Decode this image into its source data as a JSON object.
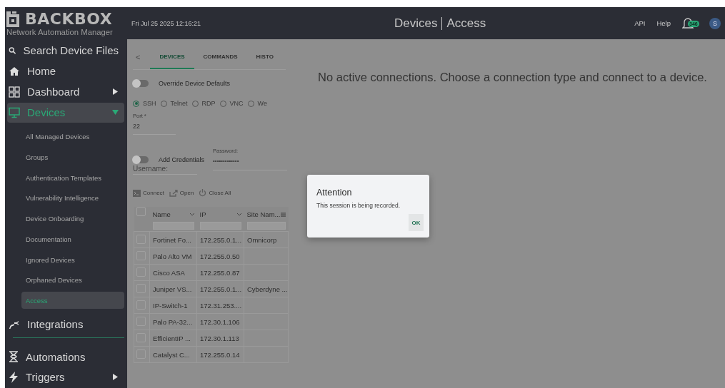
{
  "header": {
    "logo": "BACKBOX",
    "subtitle": "Network Automation Manager",
    "datetime": "Fri Jul 25 2025 12:16:21",
    "title": "Devices",
    "subtitle_right": "Access",
    "links": [
      "API",
      "Help"
    ],
    "notifications": "346",
    "avatar": "S"
  },
  "sidebar": {
    "items": [
      {
        "label": "Search Device Files",
        "selected": false
      },
      {
        "label": "Home",
        "selected": false
      },
      {
        "label": "Dashboard",
        "selected": false,
        "expanded": false
      },
      {
        "label": "Devices",
        "selected": true,
        "expanded": true,
        "children": [
          {
            "label": "All Managed Devices",
            "selected": false
          },
          {
            "label": "Groups",
            "selected": false
          },
          {
            "label": "Authentication Templates",
            "selected": false
          },
          {
            "label": "Vulnerability Intelligence",
            "selected": false
          },
          {
            "label": "Device Onboarding",
            "selected": false
          },
          {
            "label": "Documentation",
            "selected": false
          },
          {
            "label": "Ignored Devices",
            "selected": false
          },
          {
            "label": "Orphaned Devices",
            "selected": false
          },
          {
            "label": "Access",
            "selected": true
          }
        ]
      },
      {
        "label": "Integrations",
        "selected": false
      },
      {
        "label": "Automations",
        "selected": false
      },
      {
        "label": "Triggers",
        "selected": false,
        "expanded": false
      }
    ]
  },
  "tabs_prev": "<",
  "tabs": [
    {
      "label": "DEVICES",
      "selected": true
    },
    {
      "label": "COMMANDS",
      "selected": false
    },
    {
      "label": "HISTO",
      "selected": false
    }
  ],
  "override_defaults": {
    "label": "Override Device Defaults",
    "on": false
  },
  "protocols": [
    {
      "label": "SSH",
      "selected": true
    },
    {
      "label": "Telnet",
      "selected": false
    },
    {
      "label": "RDP",
      "selected": false
    },
    {
      "label": "VNC",
      "selected": false
    },
    {
      "label": "We",
      "selected": false
    }
  ],
  "port": {
    "label": "Port *",
    "value": "22"
  },
  "credentials": {
    "label": "Add Credentials",
    "on": false,
    "username_placeholder": "Username:",
    "password_label": "Password:",
    "password_value": "•••••••••••••"
  },
  "actions": [
    "Connect",
    "Open",
    "Close All"
  ],
  "table": {
    "columns": [
      "Name",
      "IP",
      "Site Nam..."
    ],
    "all_checked": false,
    "rows": [
      {
        "checked": false,
        "cells": [
          "Fortinet Fo...",
          "172.255.0.1...",
          "Omnicorp"
        ]
      },
      {
        "checked": false,
        "cells": [
          "Palo Alto VM",
          "172.255.0.50",
          ""
        ]
      },
      {
        "checked": false,
        "cells": [
          "Cisco ASA",
          "172.255.0.87",
          ""
        ]
      },
      {
        "checked": false,
        "cells": [
          "Juniper VS...",
          "172.255.0.1...",
          "Cyberdyne ..."
        ]
      },
      {
        "checked": false,
        "cells": [
          "IP-Switch-1",
          "172.31.253....",
          ""
        ]
      },
      {
        "checked": false,
        "cells": [
          "Palo PA-32...",
          "172.30.1.106",
          ""
        ]
      },
      {
        "checked": false,
        "cells": [
          "EfficientIP ...",
          "172.30.1.113",
          ""
        ]
      },
      {
        "checked": false,
        "cells": [
          "Catalyst C...",
          "172.255.0.14",
          ""
        ]
      }
    ]
  },
  "message": "No active connections. Choose a connection type and connect to a device.",
  "dialog": {
    "title": "Attention",
    "body": "This session is being recorded.",
    "button": "OK"
  }
}
